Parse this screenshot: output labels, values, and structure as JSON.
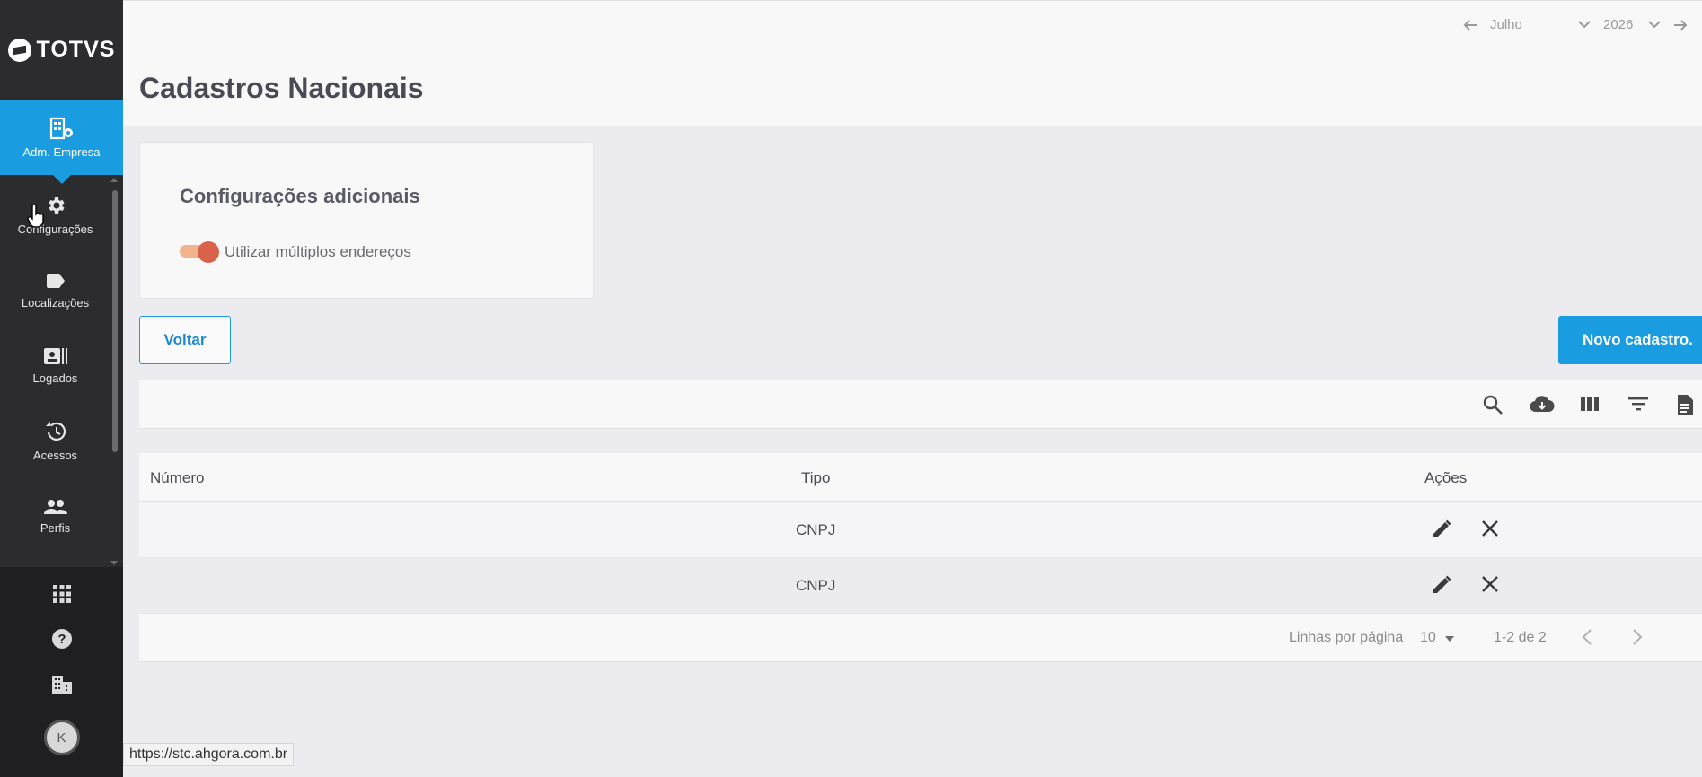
{
  "app": {
    "logo_text": "TOTVS"
  },
  "sidebar": {
    "active": {
      "label": "Adm. Empresa",
      "icon": "building-gear-icon"
    },
    "items": [
      {
        "label": "Configurações",
        "icon": "gear-icon"
      },
      {
        "label": "Localizações",
        "icon": "tag-icon"
      },
      {
        "label": "Logados",
        "icon": "badge-icon"
      },
      {
        "label": "Acessos",
        "icon": "history-icon"
      },
      {
        "label": "Perfis",
        "icon": "people-icon"
      }
    ],
    "bottom": {
      "avatar_initial": "K"
    }
  },
  "header": {
    "title": "Cadastros Nacionais",
    "period": {
      "month": "Julho",
      "year": "2026"
    }
  },
  "config_card": {
    "title": "Configurações adicionais",
    "toggle_label": "Utilizar múltiplos endereços",
    "toggle_on": true
  },
  "buttons": {
    "back": "Voltar",
    "new": "Novo cadastro."
  },
  "table": {
    "headers": {
      "numero": "Número",
      "tipo": "Tipo",
      "acoes": "Ações"
    },
    "rows": [
      {
        "numero": "",
        "tipo": "CNPJ"
      },
      {
        "numero": "",
        "tipo": "CNPJ"
      }
    ]
  },
  "pagination": {
    "rows_label": "Linhas por página",
    "page_size": "10",
    "range": "1-2 de 2"
  },
  "status_bar": {
    "url": "https://stc.ahgora.com.br"
  },
  "colors": {
    "primary": "#1a9ce0",
    "sidebar": "#2c2c2e",
    "toggle_knob": "#d9624b",
    "toggle_track": "#f2b48d"
  }
}
